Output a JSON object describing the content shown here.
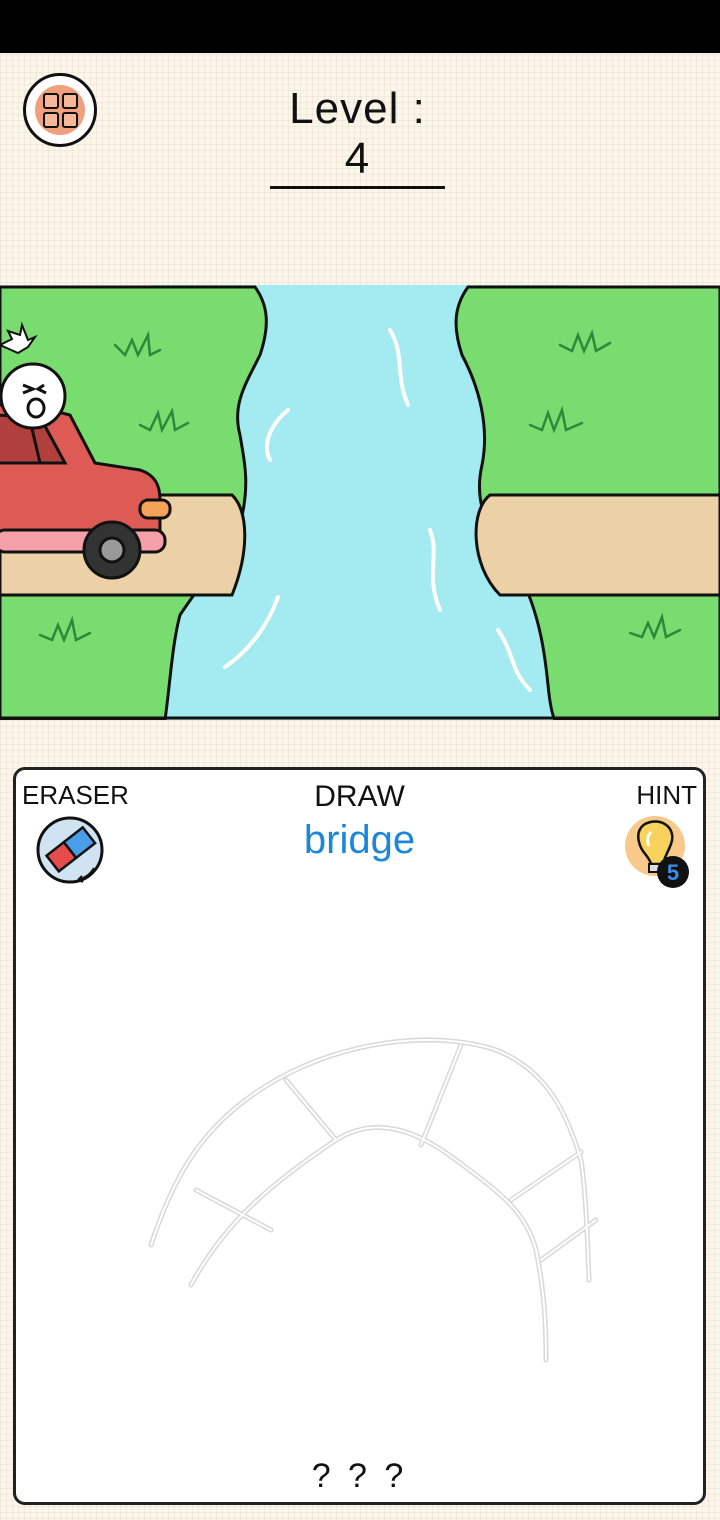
{
  "header": {
    "level_text": "Level : 4"
  },
  "menu": {
    "icon": "menu-grid-icon"
  },
  "panel": {
    "eraser_label": "ERASER",
    "draw_label": "DRAW",
    "word": "bridge",
    "hint_label": "HINT",
    "hint_count": "5",
    "answer_placeholder": "? ? ?"
  },
  "colors": {
    "grass": "#79dc6f",
    "water": "#a3ebf0",
    "road": "#ebd1a5",
    "car": "#de5b55",
    "word_blue": "#1e86d8",
    "hint_bulb": "#f7d25c"
  }
}
